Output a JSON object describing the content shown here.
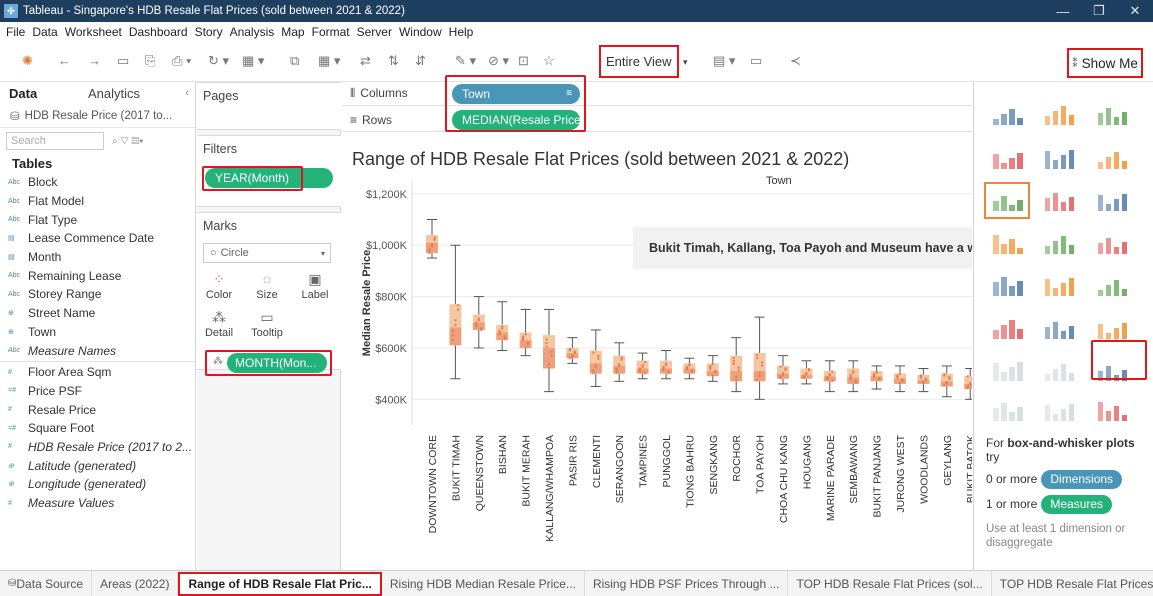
{
  "window": {
    "title": "Tableau - Singapore's HDB Resale Flat Prices (sold between 2021 & 2022)",
    "controls": [
      "—",
      "❐",
      "✕"
    ]
  },
  "menu": [
    "File",
    "Data",
    "Worksheet",
    "Dashboard",
    "Story",
    "Analysis",
    "Map",
    "Format",
    "Server",
    "Window",
    "Help"
  ],
  "toolbar": {
    "fit_value": "Entire View",
    "show_me_label": "Show Me"
  },
  "data_pane": {
    "tab_data": "Data",
    "tab_analytics": "Analytics",
    "datasource": "HDB Resale Price (2017 to...",
    "search_placeholder": "Search",
    "tables_heading": "Tables",
    "fields": [
      {
        "name": "Block",
        "icon": "Abc",
        "kind": "dim"
      },
      {
        "name": "Flat Model",
        "icon": "Abc",
        "kind": "dim"
      },
      {
        "name": "Flat Type",
        "icon": "Abc",
        "kind": "dim"
      },
      {
        "name": "Lease Commence Date",
        "icon": "▤",
        "kind": "dim"
      },
      {
        "name": "Month",
        "icon": "▤",
        "kind": "dim"
      },
      {
        "name": "Remaining Lease",
        "icon": "Abc",
        "kind": "dim"
      },
      {
        "name": "Storey Range",
        "icon": "Abc",
        "kind": "dim"
      },
      {
        "name": "Street Name",
        "icon": "⊕",
        "kind": "dim"
      },
      {
        "name": "Town",
        "icon": "⊕",
        "kind": "dim"
      },
      {
        "name": "Measure Names",
        "icon": "Abc",
        "kind": "dim-italic"
      },
      {
        "name": "Floor Area Sqm",
        "icon": "#",
        "kind": "measure"
      },
      {
        "name": "Price PSF",
        "icon": "=#",
        "kind": "measure"
      },
      {
        "name": "Resale Price",
        "icon": "#",
        "kind": "measure"
      },
      {
        "name": "Square Foot",
        "icon": "=#",
        "kind": "measure"
      },
      {
        "name": "HDB Resale Price (2017 to 2...",
        "icon": "#",
        "kind": "measure-italic"
      },
      {
        "name": "Latitude (generated)",
        "icon": "⊕",
        "kind": "measure-italic"
      },
      {
        "name": "Longitude (generated)",
        "icon": "⊕",
        "kind": "measure-italic"
      },
      {
        "name": "Measure Values",
        "icon": "#",
        "kind": "measure-italic"
      }
    ]
  },
  "cards": {
    "pages": "Pages",
    "filters": "Filters",
    "filter_pill": "YEAR(Month)",
    "marks": "Marks",
    "mark_type": "Circle",
    "mark_buttons": [
      "Color",
      "Size",
      "Label",
      "Detail",
      "Tooltip"
    ],
    "detail_pill": "MONTH(Mon..."
  },
  "shelves": {
    "columns_label": "Columns",
    "columns_pill": "Town",
    "rows_label": "Rows",
    "rows_pill": "MEDIAN(Resale Price)"
  },
  "view": {
    "title": "Range of HDB Resale Flat Prices (sold between 2021 & 2022)",
    "column_header": "Town",
    "annotation": "Bukit Timah, Kallang, Toa Payoh and Museum have a wide"
  },
  "chart_data": {
    "type": "box",
    "title": "Range of HDB Resale Flat Prices (sold between 2021 & 2022)",
    "xlabel": "Town",
    "ylabel": "Median Resale Price",
    "ylim": [
      300000,
      1250000
    ],
    "y_ticks": [
      400000,
      600000,
      800000,
      1000000,
      1200000
    ],
    "y_tick_labels": [
      "$400K",
      "$600K",
      "$800K",
      "$1,000K",
      "$1,200K"
    ],
    "categories": [
      "DOWNTOWN CORE",
      "BUKIT TIMAH",
      "QUEENSTOWN",
      "BISHAN",
      "BUKIT MERAH",
      "KALLANG/WHAMPOA",
      "PASIR RIS",
      "CLEMENTI",
      "SERANGOON",
      "TAMPINES",
      "PUNGGOL",
      "TIONG BAHRU",
      "SENGKANG",
      "ROCHOR",
      "TOA PAYOH",
      "CHOA CHU KANG",
      "HOUGANG",
      "MARINE PARADE",
      "SEMBAWANG",
      "BUKIT PANJANG",
      "JURONG WEST",
      "WOODLANDS",
      "GEYLANG",
      "BUKIT BATOK"
    ],
    "boxes": [
      {
        "min": 950000,
        "q1": 970000,
        "median": 1010000,
        "q3": 1040000,
        "max": 1100000
      },
      {
        "min": 480000,
        "q1": 610000,
        "median": 680000,
        "q3": 770000,
        "max": 1000000
      },
      {
        "min": 600000,
        "q1": 670000,
        "median": 700000,
        "q3": 730000,
        "max": 800000
      },
      {
        "min": 590000,
        "q1": 630000,
        "median": 660000,
        "q3": 690000,
        "max": 780000
      },
      {
        "min": 570000,
        "q1": 600000,
        "median": 630000,
        "q3": 660000,
        "max": 750000
      },
      {
        "min": 430000,
        "q1": 520000,
        "median": 600000,
        "q3": 650000,
        "max": 750000
      },
      {
        "min": 540000,
        "q1": 560000,
        "median": 580000,
        "q3": 600000,
        "max": 640000
      },
      {
        "min": 450000,
        "q1": 500000,
        "median": 540000,
        "q3": 590000,
        "max": 670000
      },
      {
        "min": 470000,
        "q1": 500000,
        "median": 530000,
        "q3": 570000,
        "max": 620000
      },
      {
        "min": 480000,
        "q1": 500000,
        "median": 520000,
        "q3": 550000,
        "max": 580000
      },
      {
        "min": 480000,
        "q1": 500000,
        "median": 520000,
        "q3": 550000,
        "max": 590000
      },
      {
        "min": 480000,
        "q1": 500000,
        "median": 520000,
        "q3": 540000,
        "max": 560000
      },
      {
        "min": 470000,
        "q1": 490000,
        "median": 510000,
        "q3": 540000,
        "max": 570000
      },
      {
        "min": 430000,
        "q1": 470000,
        "median": 510000,
        "q3": 570000,
        "max": 640000
      },
      {
        "min": 400000,
        "q1": 470000,
        "median": 510000,
        "q3": 580000,
        "max": 720000
      },
      {
        "min": 460000,
        "q1": 480000,
        "median": 500000,
        "q3": 530000,
        "max": 570000
      },
      {
        "min": 460000,
        "q1": 480000,
        "median": 495000,
        "q3": 520000,
        "max": 550000
      },
      {
        "min": 430000,
        "q1": 470000,
        "median": 490000,
        "q3": 510000,
        "max": 550000
      },
      {
        "min": 430000,
        "q1": 460000,
        "median": 485000,
        "q3": 520000,
        "max": 550000
      },
      {
        "min": 440000,
        "q1": 470000,
        "median": 490000,
        "q3": 510000,
        "max": 530000
      },
      {
        "min": 430000,
        "q1": 460000,
        "median": 480000,
        "q3": 500000,
        "max": 530000
      },
      {
        "min": 430000,
        "q1": 460000,
        "median": 475000,
        "q3": 495000,
        "max": 520000
      },
      {
        "min": 410000,
        "q1": 450000,
        "median": 470000,
        "q3": 500000,
        "max": 530000
      },
      {
        "min": 400000,
        "q1": 440000,
        "median": 460000,
        "q3": 490000,
        "max": 520000
      }
    ],
    "colors": {
      "box_upper": "#f4c6a2",
      "box_lower": "#ee9f7c",
      "points": "#e8763f",
      "whisker": "#555555"
    }
  },
  "show_me": {
    "hint_prefix": "For ",
    "hint_bold": "box-and-whisker plots",
    "hint_suffix": " try",
    "dim_prefix": "0 or more",
    "dim_pill": "Dimensions",
    "mea_prefix": "1 or more",
    "mea_pill": "Measures",
    "footer": "Use at least 1 dimension or disaggregate"
  },
  "tabs": {
    "items": [
      "Data Source",
      "Areas (2022)",
      "Range of HDB Resale Flat Pric...",
      "Rising HDB Median Resale Price...",
      "Rising HDB PSF Prices Through ...",
      "TOP HDB Resale Flat Prices (sol...",
      "TOP HDB Resale Flat Prices PSF..."
    ],
    "active_index": 2
  }
}
